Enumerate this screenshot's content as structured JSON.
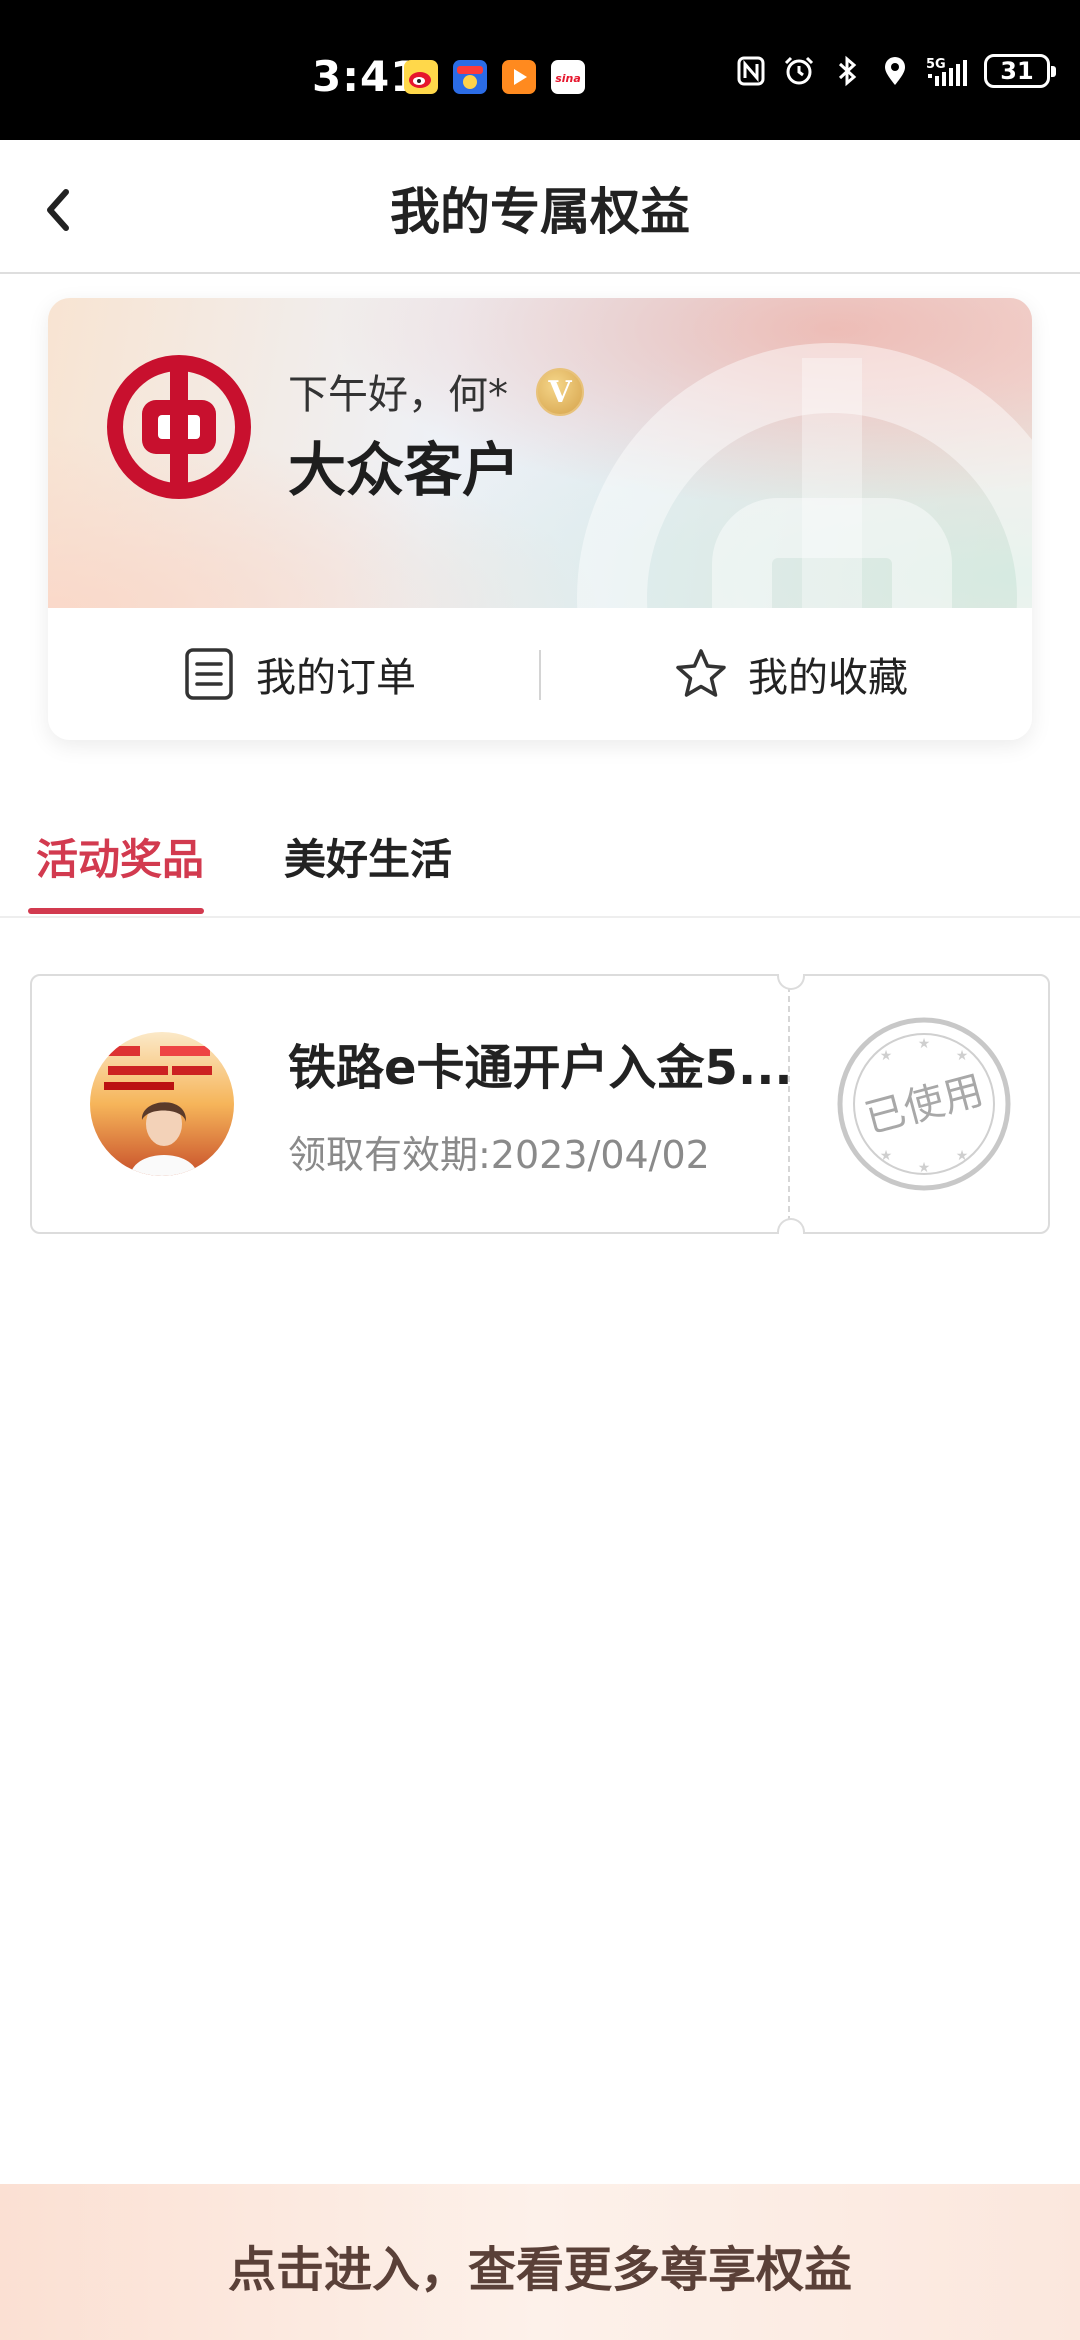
{
  "status_bar": {
    "time": "3:41",
    "battery": "31",
    "network": "5G"
  },
  "nav": {
    "title": "我的专属权益"
  },
  "profile": {
    "greeting": "下午好，何*",
    "vip_letter": "V",
    "level": "大众客户",
    "orders_label": "我的订单",
    "favorites_label": "我的收藏"
  },
  "tabs": [
    {
      "label": "活动奖品",
      "active": true
    },
    {
      "label": "美好生活",
      "active": false
    }
  ],
  "coupons": [
    {
      "title": "铁路e卡通开户入金5...",
      "date": "领取有效期:2023/04/02",
      "status": "已使用"
    }
  ],
  "banner": {
    "text": "点击进入，查看更多尊享权益"
  },
  "colors": {
    "accent": "#d23a4f",
    "boc_red": "#c8102e"
  }
}
